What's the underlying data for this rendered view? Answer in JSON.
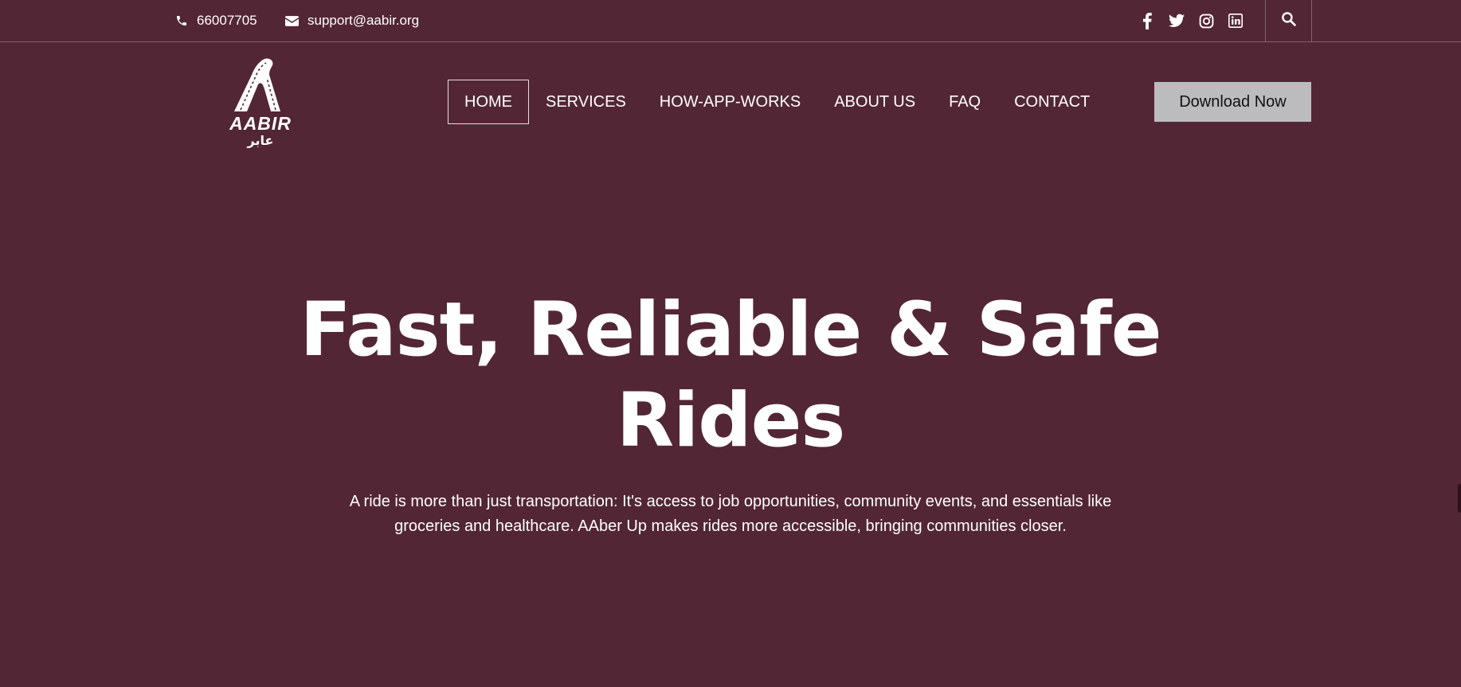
{
  "topbar": {
    "phone": "66007705",
    "email": "support@aabir.org",
    "icons": [
      "phone-icon",
      "envelope-icon",
      "facebook-icon",
      "twitter-icon",
      "instagram-icon",
      "linkedin-icon",
      "search-icon"
    ]
  },
  "logo": {
    "text": "AABIR",
    "arabic_text": "عابر"
  },
  "nav": {
    "items": [
      {
        "label": "HOME",
        "active": true
      },
      {
        "label": "SERVICES"
      },
      {
        "label": "HOW-APP-WORKS"
      },
      {
        "label": "ABOUT US"
      },
      {
        "label": "FAQ"
      },
      {
        "label": "CONTACT"
      }
    ]
  },
  "cta": {
    "download_label": "Download Now"
  },
  "hero": {
    "title_line1": "Fast, Reliable & Safe",
    "title_line2": "Rides",
    "subtitle": "A ride is more than just transportation: It's access to job opportunities, community events, and essentials like groceries and healthcare. AAber Up makes rides more accessible, bringing communities closer."
  },
  "colors": {
    "background": "#532635",
    "button_bg": "#bcbcbe",
    "text": "#ffffff"
  }
}
